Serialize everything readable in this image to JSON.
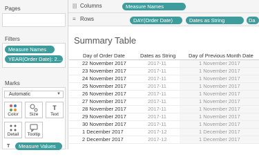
{
  "left_pane": {
    "pages_title": "Pages",
    "filters_title": "Filters",
    "filters": [
      "Measure Names",
      "YEAR(Order Date): 2..."
    ],
    "marks_title": "Marks",
    "mark_type": "Automatic",
    "mark_buttons": [
      {
        "label": "Color",
        "icon": "color-dots-icon"
      },
      {
        "label": "Size",
        "icon": "size-circles-icon"
      },
      {
        "label": "Text",
        "icon": "text-t-icon"
      },
      {
        "label": "Detail",
        "icon": "detail-dots-icon"
      },
      {
        "label": "Tooltip",
        "icon": "tooltip-bubble-icon"
      }
    ],
    "measure_values_pill": "Measure Values"
  },
  "shelves": {
    "columns_label": "Columns",
    "columns_pills": [
      "Measure Names"
    ],
    "rows_label": "Rows",
    "rows_pills": [
      "DAY(Order Date)",
      "Dates as String",
      "Da"
    ]
  },
  "sheet": {
    "title": "Summary Table",
    "headers": [
      "Day of Order Date",
      "Dates as String",
      "Day of Previous Month Date"
    ],
    "rows": [
      [
        "22 November 2017",
        "2017-11",
        "1 November 2017"
      ],
      [
        "23 November 2017",
        "2017-11",
        "1 November 2017"
      ],
      [
        "24 November 2017",
        "2017-11",
        "1 November 2017"
      ],
      [
        "25 November 2017",
        "2017-11",
        "1 November 2017"
      ],
      [
        "26 November 2017",
        "2017-11",
        "1 November 2017"
      ],
      [
        "27 November 2017",
        "2017-11",
        "1 November 2017"
      ],
      [
        "28 November 2017",
        "2017-11",
        "1 November 2017"
      ],
      [
        "29 November 2017",
        "2017-11",
        "1 November 2017"
      ],
      [
        "30 November 2017",
        "2017-11",
        "1 November 2017"
      ],
      [
        "1 December 2017",
        "2017-12",
        "1 December 2017"
      ],
      [
        "2 December 2017",
        "2017-12",
        "1 December 2017"
      ]
    ]
  },
  "colors": {
    "pill": "#3f9c9c",
    "pane_bg": "#f5f5f5",
    "muted_text": "#999999"
  }
}
